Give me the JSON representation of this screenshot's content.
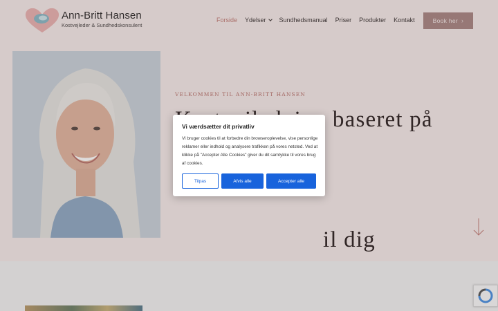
{
  "header": {
    "brand_name": "Ann-Britt Hansen",
    "brand_tagline": "Kostvejleder & Sundhedskonsulent",
    "nav": [
      {
        "label": "Forside",
        "active": true
      },
      {
        "label": "Ydelser",
        "has_dropdown": true
      },
      {
        "label": "Sundhedsmanual"
      },
      {
        "label": "Priser"
      },
      {
        "label": "Produkter"
      },
      {
        "label": "Kontakt"
      }
    ],
    "book_button": "Book her",
    "book_button_icon": "arrow-right-icon"
  },
  "hero": {
    "eyebrow": "VELKOMMEN TIL ANN-BRITT HANSEN",
    "headline_line1": "Kostvejledning baseret på analyse",
    "headline_line2": "",
    "headline_line3": "il dig",
    "scroll_icon": "arrow-down-icon"
  },
  "cookie_banner": {
    "title": "Vi værdsætter dit privatliv",
    "text": "Vi bruger cookies til at forbedre din browseroplevelse, vise personlige reklamer eller indhold og analysere trafikken på vores netsted. Ved at klikke på \"Accepter Alle Cookies\" giver du dit samtykke til vores brug af cookies.",
    "customize_label": "Tilpas",
    "reject_label": "Afvis alle",
    "accept_label": "Accepter alle"
  },
  "colors": {
    "background": "#f6ebe9",
    "accent": "#c07a74",
    "button": "#a98583",
    "cookie_primary": "#1863dc"
  }
}
